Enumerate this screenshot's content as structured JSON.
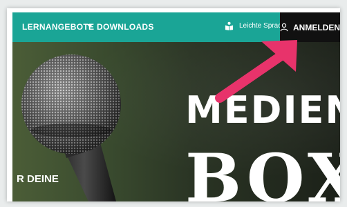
{
  "nav": {
    "learning_offers": "LERNANGEBOTE",
    "caret_icon": "chevron-down-icon",
    "downloads": "DOWNLOADS",
    "easy_language": "Leichte Sprache",
    "easy_language_icon": "book-reader-icon",
    "login": "ANMELDEN",
    "login_icon": "user-icon"
  },
  "hero": {
    "title": "MEDIEN",
    "subtitle": "BOX",
    "side_text": "R DEINE"
  },
  "colors": {
    "nav_bg": "#1aa596",
    "login_bg": "#111111",
    "arrow": "#e8336b"
  }
}
